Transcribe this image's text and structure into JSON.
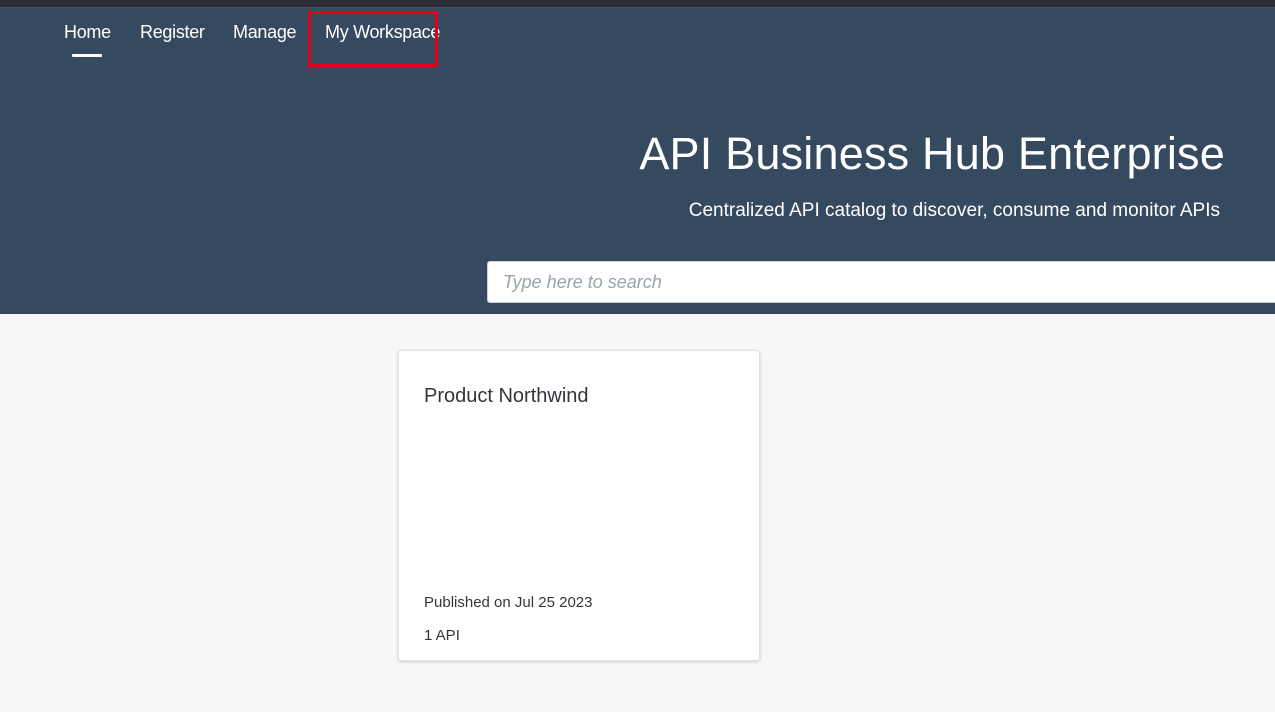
{
  "nav": {
    "items": [
      {
        "label": "Home",
        "active": true
      },
      {
        "label": "Register",
        "active": false
      },
      {
        "label": "Manage",
        "active": false
      },
      {
        "label": "My Workspace",
        "active": false,
        "highlighted": true
      }
    ]
  },
  "hero": {
    "title": "API Business Hub Enterprise",
    "subtitle": "Centralized API catalog to discover, consume and monitor APIs"
  },
  "search": {
    "placeholder": "Type here to search",
    "value": ""
  },
  "cards": [
    {
      "title": "Product Northwind",
      "published": "Published on Jul 25 2023",
      "count": "1 API"
    }
  ],
  "colors": {
    "hero_background": "#354a5f",
    "page_background": "#f7f7f7",
    "highlight_border": "#e0001b",
    "text_primary": "#32363a"
  }
}
